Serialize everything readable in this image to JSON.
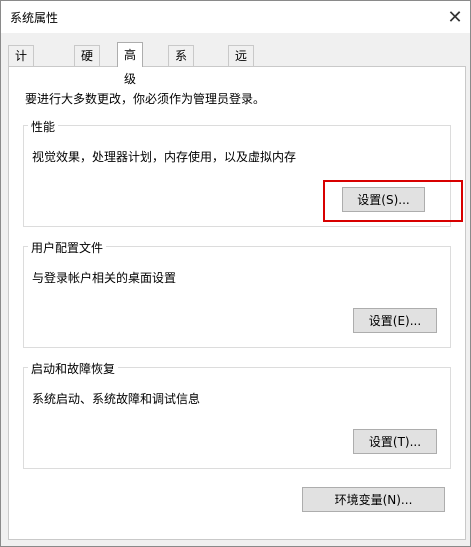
{
  "window": {
    "title": "系统属性",
    "behind_text": "……  ……"
  },
  "tabs": [
    {
      "label": "计算机名"
    },
    {
      "label": "硬件"
    },
    {
      "label": "高级"
    },
    {
      "label": "系统保护"
    },
    {
      "label": "远程"
    }
  ],
  "active_tab": "高级",
  "admin_note": "要进行大多数更改，你必须作为管理员登录。",
  "groups": {
    "performance": {
      "title": "性能",
      "desc": "视觉效果，处理器计划，内存使用，以及虚拟内存",
      "button": "设置(S)..."
    },
    "profiles": {
      "title": "用户配置文件",
      "desc": "与登录帐户相关的桌面设置",
      "button": "设置(E)..."
    },
    "startup": {
      "title": "启动和故障恢复",
      "desc": "系统启动、系统故障和调试信息",
      "button": "设置(T)..."
    }
  },
  "env_button": "环境变量(N)...",
  "colors": {
    "highlight": "#d80000",
    "button_bg": "#e1e1e1",
    "panel_bg": "#ffffff",
    "window_bg": "#f0f0f0"
  },
  "icons": {
    "close": "close-icon"
  }
}
